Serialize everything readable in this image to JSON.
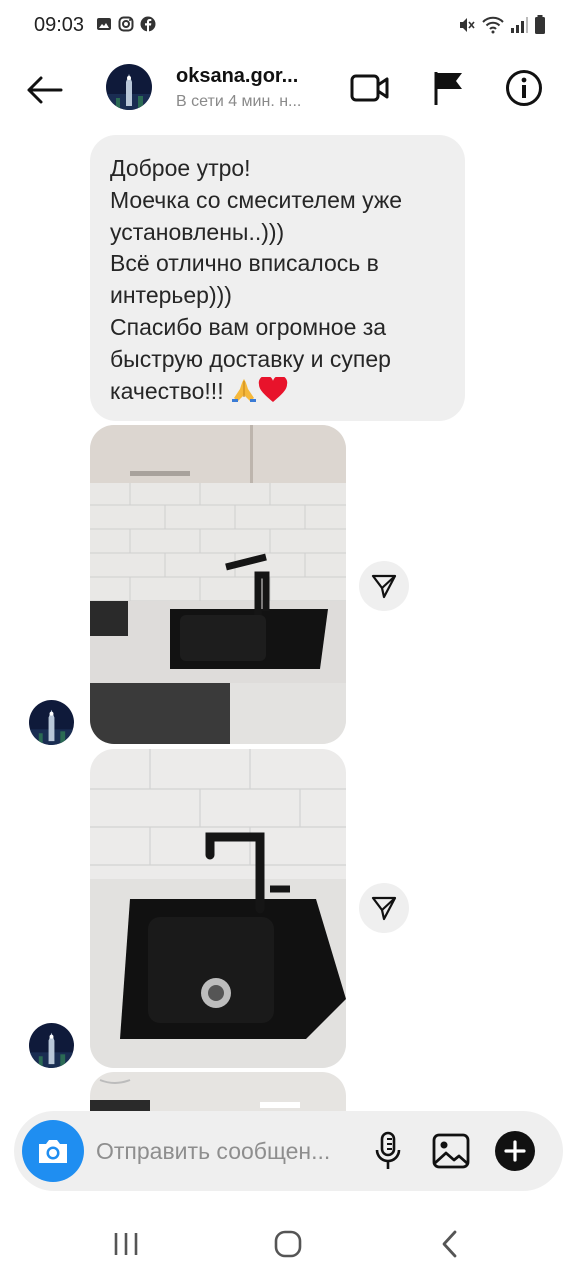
{
  "status_bar": {
    "time": "09:03",
    "left_icons": [
      "gallery-icon",
      "instagram-icon",
      "facebook-icon"
    ],
    "right_icons": [
      "mute-icon",
      "wifi-icon",
      "signal-icon",
      "battery-icon"
    ]
  },
  "header": {
    "username": "oksana.gor...",
    "status": "В сети 4 мин. н...",
    "buttons": [
      "back-arrow-icon",
      "video-camera-icon",
      "flag-icon",
      "info-icon"
    ]
  },
  "messages": [
    {
      "type": "text",
      "lines": [
        "Доброе утро!",
        "Моечка со смесителем уже",
        "установлены..)))",
        "Всё отлично вписалось в",
        "интерьер)))",
        "Спасибо вам огромное за",
        "быструю доставку и супер",
        "качество!!!"
      ],
      "emojis": [
        "folded-hands-emoji",
        "red-heart-emoji"
      ]
    },
    {
      "type": "photo",
      "subject": "black granite sink with black faucet, white tiles"
    },
    {
      "type": "photo",
      "subject": "close-up of black granite sink with drain and faucet"
    },
    {
      "type": "photo",
      "subject": "partially visible kitchen photo"
    }
  ],
  "composer": {
    "placeholder": "Отправить сообщен...",
    "buttons": [
      "camera-icon",
      "microphone-icon",
      "gallery-icon",
      "plus-icon"
    ]
  },
  "nav_bar": {
    "buttons": [
      "recent-apps-icon",
      "home-icon",
      "back-icon"
    ]
  },
  "colors": {
    "accent": "#1f8ef1",
    "bubble": "#efefef",
    "muted_text": "#8a8a8a",
    "heart": "#e8132b"
  }
}
